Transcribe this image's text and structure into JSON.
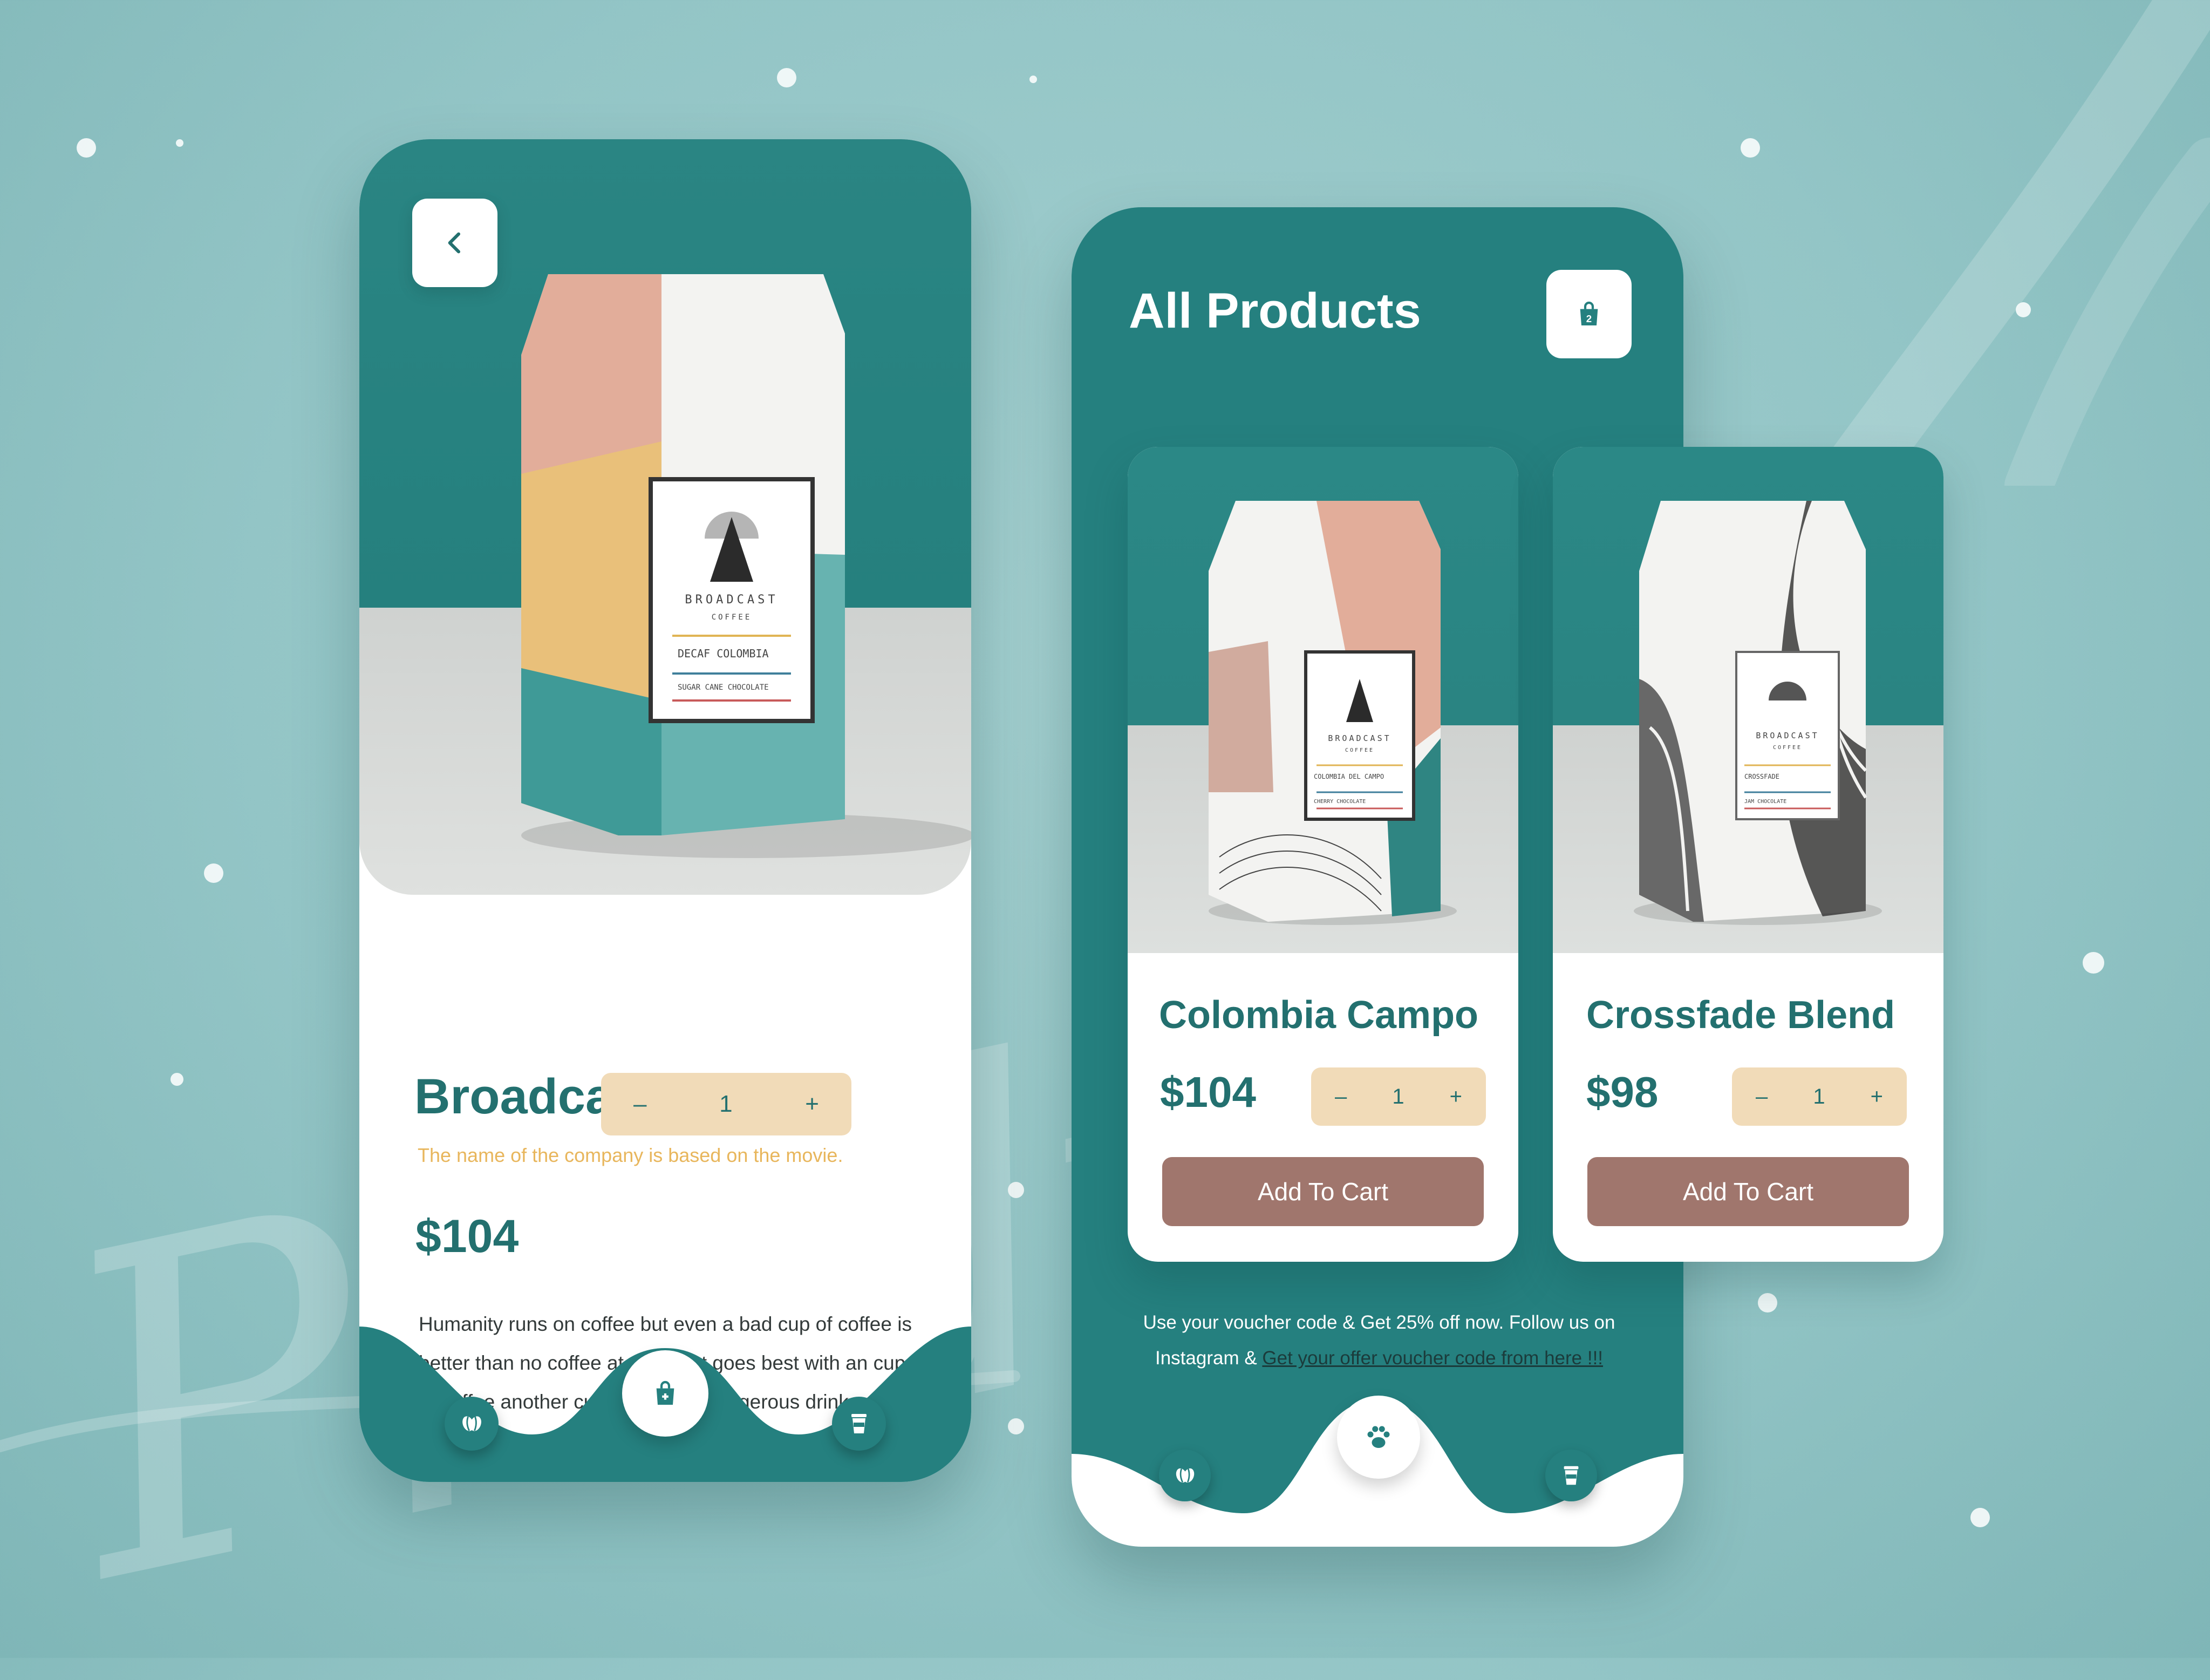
{
  "background": {
    "script_word": "Product",
    "color": "#93c5c6"
  },
  "detail": {
    "back_icon": "chevron-left-icon",
    "product_name": "Broadcast Coffee",
    "tagline": "The name of the company is based on the movie.",
    "price": "$104",
    "stepper": {
      "minus": "–",
      "quantity": "1",
      "plus": "+"
    },
    "description": "Humanity runs on coffee but even a bad cup of coffee is better than no coffee at all. What goes best with an cup of coffee another cup. The most dangerous drinks game is seeing how long I can go without coffee.",
    "bag_label": {
      "brand": "BROADCAST",
      "sub": "COFFEE",
      "blend": "DECAF COLOMBIA",
      "notes": "SUGAR CANE CHOCOLATE"
    },
    "nav": {
      "left_icon": "coffee-bean-icon",
      "center_icon": "shopping-bag-add-icon",
      "right_icon": "coffee-cup-icon"
    }
  },
  "list": {
    "title": "All Products",
    "cart_icon": "shopping-bag-icon",
    "cart_count": "2",
    "products": [
      {
        "name": "Colombia Campo",
        "price": "$104",
        "stepper": {
          "minus": "–",
          "quantity": "1",
          "plus": "+"
        },
        "cta": "Add To Cart",
        "bag_label": {
          "brand": "BROADCAST",
          "sub": "COFFEE",
          "blend": "COLOMBIA DEL CAMPO",
          "notes": "CHERRY CHOCOLATE"
        }
      },
      {
        "name": "Crossfade Blend",
        "price": "$98",
        "stepper": {
          "minus": "–",
          "quantity": "1",
          "plus": "+"
        },
        "cta": "Add To Cart",
        "bag_label": {
          "brand": "BROADCAST",
          "sub": "COFFEE",
          "blend": "CROSSFADE",
          "notes": "JAM CHOCOLATE"
        }
      }
    ],
    "promo_text": "Use your voucher code & Get 25% off now. Follow us on Instagram & ",
    "promo_link": "Get your offer voucher code from here !!!",
    "nav": {
      "left_icon": "coffee-bean-icon",
      "center_icon": "paw-icon",
      "right_icon": "coffee-cup-icon"
    }
  },
  "colors": {
    "teal": "#25807f",
    "dark_teal_text": "#23706f",
    "tagline_yellow": "#e8b65c",
    "stepper_bg": "#f1dbb8",
    "cta_brown": "#a0766d"
  }
}
